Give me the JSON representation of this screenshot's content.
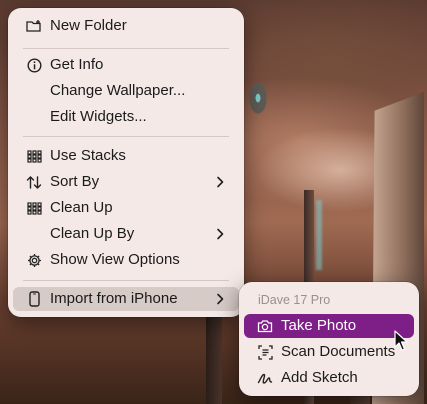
{
  "main_menu": {
    "items": [
      {
        "label": "New Folder",
        "icon": "folder-badge-plus-icon"
      },
      {
        "label": "Get Info",
        "icon": "info-circle-icon"
      },
      {
        "label": "Change Wallpaper..."
      },
      {
        "label": "Edit Widgets..."
      },
      {
        "label": "Use Stacks",
        "icon": "stacks-grid-icon"
      },
      {
        "label": "Sort By",
        "icon": "sort-arrows-icon",
        "submenu": true
      },
      {
        "label": "Clean Up",
        "icon": "clean-up-grid-icon"
      },
      {
        "label": "Clean Up By",
        "submenu": true
      },
      {
        "label": "Show View Options",
        "icon": "gear-icon"
      },
      {
        "label": "Import from iPhone",
        "icon": "iphone-icon",
        "submenu": true,
        "state": "highlighted"
      }
    ]
  },
  "sub_menu": {
    "section_label": "iDave 17 Pro",
    "items": [
      {
        "label": "Take Photo",
        "icon": "camera-icon",
        "state": "selected"
      },
      {
        "label": "Scan Documents",
        "icon": "document-scan-icon"
      },
      {
        "label": "Add Sketch",
        "icon": "sketch-signature-icon"
      }
    ]
  },
  "colors": {
    "menu_background": "#f4e9e6",
    "selection": "#7d1f86",
    "hover_highlight": "#d7cbc8"
  }
}
